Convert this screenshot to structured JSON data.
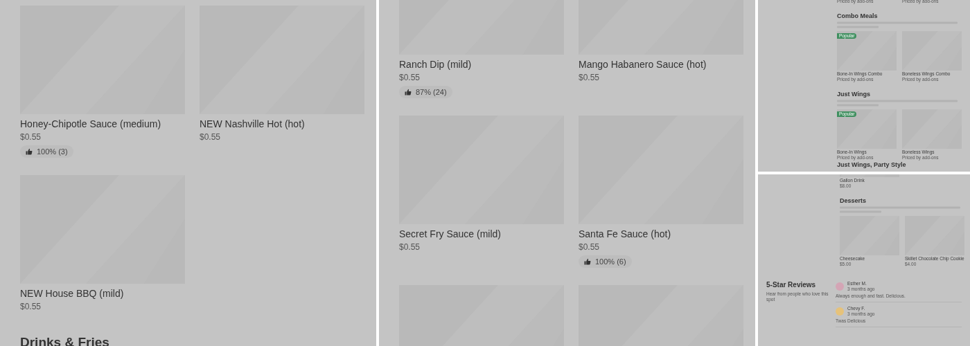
{
  "panels": [
    {
      "kind": "menu",
      "items": [
        {
          "kind": "item",
          "name": "Honey-Chipotle Sauce (medium)",
          "price": "$0.55",
          "rating": "100% (3)"
        },
        {
          "kind": "item",
          "name": "NEW Nashville Hot (hot)",
          "price": "$0.55"
        },
        {
          "kind": "item",
          "name": "NEW House BBQ (mild)",
          "price": "$0.55"
        }
      ],
      "next_section": "Drinks & Fries"
    },
    {
      "kind": "menu",
      "items": [
        {
          "kind": "item",
          "name": "Ranch Dip (mild)",
          "price": "$0.55",
          "rating": "87% (24)"
        },
        {
          "kind": "item",
          "name": "Mango Habanero Sauce (hot)",
          "price": "$0.55"
        },
        {
          "kind": "item",
          "name": "Secret Fry Sauce (mild)",
          "price": "$0.55"
        },
        {
          "kind": "item",
          "name": "Santa Fe Sauce (hot)",
          "price": "$0.55",
          "rating": "100% (6)"
        },
        {
          "kind": "image"
        },
        {
          "kind": "image"
        }
      ]
    },
    {
      "kind": "mini",
      "sections": [
        {
          "kind": "items-only",
          "items": [
            {
              "kind": "text",
              "note": "Priced by add-ons"
            },
            {
              "kind": "text",
              "note": "Priced by add-ons"
            }
          ]
        },
        {
          "kind": "full",
          "title": "Combo Meals",
          "items": [
            {
              "kind": "card",
              "name": "Bone-In Wings Combo",
              "note": "Priced by add-ons",
              "badge": "Popular"
            },
            {
              "kind": "card",
              "name": "Boneless Wings Combo",
              "note": "Priced by add-ons"
            }
          ]
        },
        {
          "kind": "full",
          "title": "Just Wings",
          "items": [
            {
              "kind": "card",
              "name": "Bone-In Wings",
              "note": "Priced by add-ons",
              "badge": "Popular"
            },
            {
              "kind": "card",
              "name": "Boneless Wings",
              "note": "Priced by add-ons"
            }
          ]
        },
        {
          "kind": "heading-only",
          "title": "Just Wings, Party Style"
        }
      ]
    },
    {
      "kind": "mini",
      "sections": [
        {
          "kind": "items-only",
          "items": [
            {
              "kind": "card",
              "name": "Gallon Drink",
              "note": "$8.00"
            }
          ]
        },
        {
          "kind": "full",
          "title": "Desserts",
          "items": [
            {
              "kind": "card",
              "name": "Cheesecake",
              "note": "$5.00"
            },
            {
              "kind": "card",
              "name": "Skillet Chocolate Chip Cookie",
              "note": "$4.00"
            }
          ]
        }
      ],
      "reviews": {
        "title": "5-Star Reviews",
        "subtitle": "Hear from people who love this spot",
        "entries": [
          {
            "author": "Esther M.",
            "time": "3 months ago",
            "text": "Always enough and fast. Delicious.",
            "color": "#d4a5b5"
          },
          {
            "author": "Chevy F.",
            "time": "3 months ago",
            "text": "Twas Delicious",
            "color": "#e6c27a"
          }
        ]
      }
    }
  ]
}
